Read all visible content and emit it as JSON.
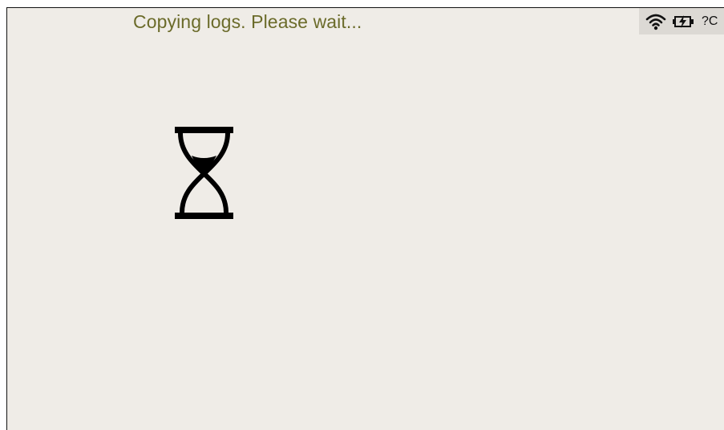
{
  "screen": {
    "message": "Copying logs. Please wait...",
    "icons": {
      "busy": "hourglass-icon",
      "wifi": "wifi-icon",
      "battery": "battery-charging-icon"
    },
    "status_text": "?C"
  },
  "colors": {
    "background": "#efece7",
    "message_text": "#6b6b2a",
    "status_bar": "#dcd9d4",
    "icon": "#000000"
  }
}
